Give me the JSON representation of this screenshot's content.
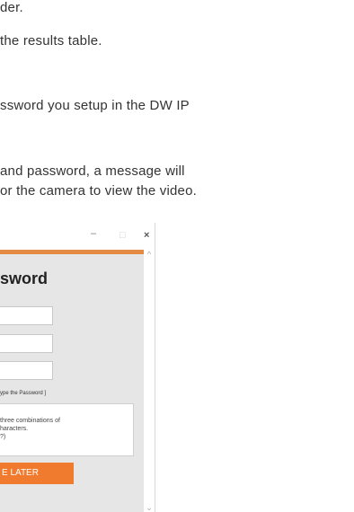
{
  "document": {
    "lines": [
      "der.",
      "the results table.",
      "ssword you setup in the DW IP",
      "and password, a message will",
      "or the camera to view the video."
    ]
  },
  "window": {
    "controls": {
      "minimize": "–",
      "maximize": "□",
      "close": "×"
    },
    "heading": "sword",
    "retype_hint": "ype the Password ]",
    "password_hint_lines": [
      "three combinations of",
      "haracters.",
      "?)"
    ],
    "later_button": "E LATER",
    "scroll_up": "^",
    "scroll_down": "⌄"
  },
  "colors": {
    "accent": "#f07a2e",
    "accent_bar": "#e58a45",
    "panel": "#e6e6e6"
  }
}
